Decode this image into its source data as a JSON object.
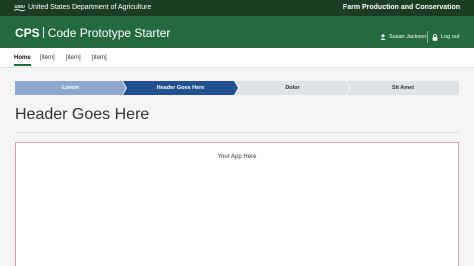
{
  "usda_bar": {
    "logo_text": "USDA",
    "department": "United States Department of Agriculture",
    "agency": "Farm Production and Conservation"
  },
  "header": {
    "app_abbr": "CPS",
    "app_name": "Code Prototype Starter",
    "user_name": "Susan Jackson",
    "logout_label": "Log out"
  },
  "nav": {
    "items": [
      {
        "label": "Home",
        "active": true
      },
      {
        "label": "[item]",
        "active": false
      },
      {
        "label": "[item]",
        "active": false
      },
      {
        "label": "[item]",
        "active": false
      }
    ]
  },
  "stepper": {
    "steps": [
      {
        "label": "Lorem",
        "state": "complete"
      },
      {
        "label": "Header Goes Here",
        "state": "current"
      },
      {
        "label": "Dolor",
        "state": "upcoming"
      },
      {
        "label": "Sit Amet",
        "state": "upcoming"
      }
    ],
    "colors": {
      "complete": "#8ea8ce",
      "current": "#21528f",
      "upcoming": "#dfe3ea"
    }
  },
  "page": {
    "title": "Header Goes Here",
    "app_placeholder": "Your App Here"
  },
  "colors": {
    "usda_bar": "#1a3d24",
    "header": "#236a3f",
    "frame_border": "#d9a0a6"
  }
}
